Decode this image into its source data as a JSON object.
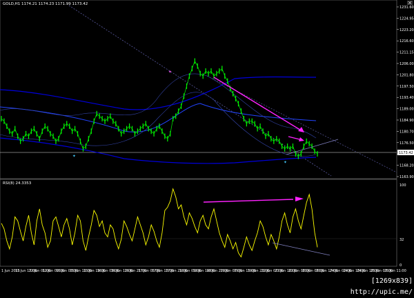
{
  "chart_data": [
    {
      "type": "line",
      "title": "GOLD,H1  1174.21 1174.23 1171.99 1173.42",
      "symbol_header": "GOLD,H1",
      "ohlc_header": "1174.21 1174.23 1171.99 1173.42",
      "y_ticks": [
        "1231.60",
        "1224.95",
        "1223.20",
        "1216.60",
        "1211.15",
        "1206.00",
        "1201.80",
        "1197.50",
        "1193.40",
        "1189.00",
        "1184.90",
        "1180.70",
        "1176.50",
        "1172.40",
        "1168.20",
        "1163.90"
      ],
      "current_price_label": "1173.42",
      "ylim": [
        1163.9,
        1231.6
      ],
      "price_series": [
        1187,
        1186,
        1184,
        1182,
        1181,
        1183,
        1180,
        1178,
        1179,
        1181,
        1180,
        1182,
        1183,
        1181,
        1179,
        1182,
        1184,
        1183,
        1181,
        1180,
        1178,
        1179,
        1182,
        1184,
        1185,
        1184,
        1182,
        1183,
        1181,
        1178,
        1175,
        1176,
        1179,
        1182,
        1186,
        1189,
        1188,
        1187,
        1186,
        1187,
        1188,
        1186,
        1185,
        1183,
        1181,
        1182,
        1183,
        1184,
        1183,
        1181,
        1182,
        1183,
        1184,
        1185,
        1183,
        1182,
        1181,
        1183,
        1184,
        1182,
        1180,
        1179,
        1181,
        1187,
        1188,
        1190,
        1192,
        1196,
        1200,
        1204,
        1207,
        1210,
        1208,
        1205,
        1204,
        1206,
        1205,
        1206,
        1204,
        1205,
        1206,
        1207,
        1204,
        1202,
        1199,
        1197,
        1195,
        1193,
        1190,
        1187,
        1185,
        1186,
        1186,
        1185,
        1183,
        1184,
        1182,
        1180,
        1181,
        1179,
        1178,
        1179,
        1178,
        1176,
        1175,
        1176,
        1175,
        1176,
        1173,
        1172,
        1173,
        1176,
        1178,
        1177,
        1176,
        1174,
        1173
      ]
    },
    {
      "type": "line",
      "title": "RSI(8) 24.3353",
      "ylim": [
        0,
        100
      ],
      "y_ticks": [
        "100",
        "32",
        "0"
      ],
      "x_labels": [
        "1 Jun 2015",
        "11 Jun 17:00",
        "12 Jun 01:00",
        "12 Jun 09:00",
        "15 Jun 03:00",
        "15 Jun 11:00",
        "15 Jun 19:00",
        "16 Jun 03:00",
        "16 Jun 12:00",
        "16 Jun 21:00",
        "17 Jun 05:00",
        "17 Jun 13:00",
        "17 Jun 21:00",
        "18 Jun 05:00",
        "18 Jun 14:00",
        "18 Jun 22:00",
        "19 Jun 07:00",
        "19 Jun 15:00",
        "19 Jun 23:00",
        "22 Jun 07:00",
        "22 Jun 16:00",
        "23 Jun 00:00",
        "23 Jun 09:00",
        "23 Jun 17:00",
        "24 Jun 02:00",
        "24 Jun 10:00",
        "24 Jun 18:00",
        "25 Jun 03:00",
        "25 Jun 11:00"
      ],
      "rsi_series": [
        52,
        45,
        30,
        20,
        35,
        60,
        55,
        42,
        30,
        48,
        62,
        40,
        25,
        55,
        70,
        50,
        40,
        22,
        30,
        55,
        60,
        48,
        35,
        50,
        58,
        45,
        25,
        40,
        62,
        55,
        30,
        18,
        35,
        50,
        68,
        62,
        48,
        55,
        40,
        35,
        50,
        45,
        30,
        20,
        32,
        55,
        48,
        38,
        30,
        45,
        60,
        50,
        40,
        25,
        35,
        50,
        42,
        30,
        22,
        40,
        68,
        72,
        80,
        95,
        85,
        70,
        75,
        60,
        50,
        65,
        58,
        48,
        40,
        55,
        62,
        50,
        45,
        60,
        70,
        55,
        40,
        30,
        22,
        38,
        30,
        20,
        28,
        15,
        10,
        22,
        35,
        25,
        18,
        30,
        40,
        55,
        48,
        35,
        25,
        38,
        30,
        20,
        35,
        55,
        65,
        50,
        40,
        60,
        70,
        55,
        45,
        62,
        78,
        88,
        70,
        40,
        22
      ]
    }
  ],
  "colors": {
    "background": "#000000",
    "candles": "#00ff00",
    "bands_inner": "#3355ff",
    "bands_outer": "#0000cc",
    "trendline": "#5a5aa0",
    "divergence": "#ff22ff",
    "rsi": "#ffff00",
    "arrows": "#44ccff"
  },
  "watermark": "[1269x839] http://upic.me/"
}
